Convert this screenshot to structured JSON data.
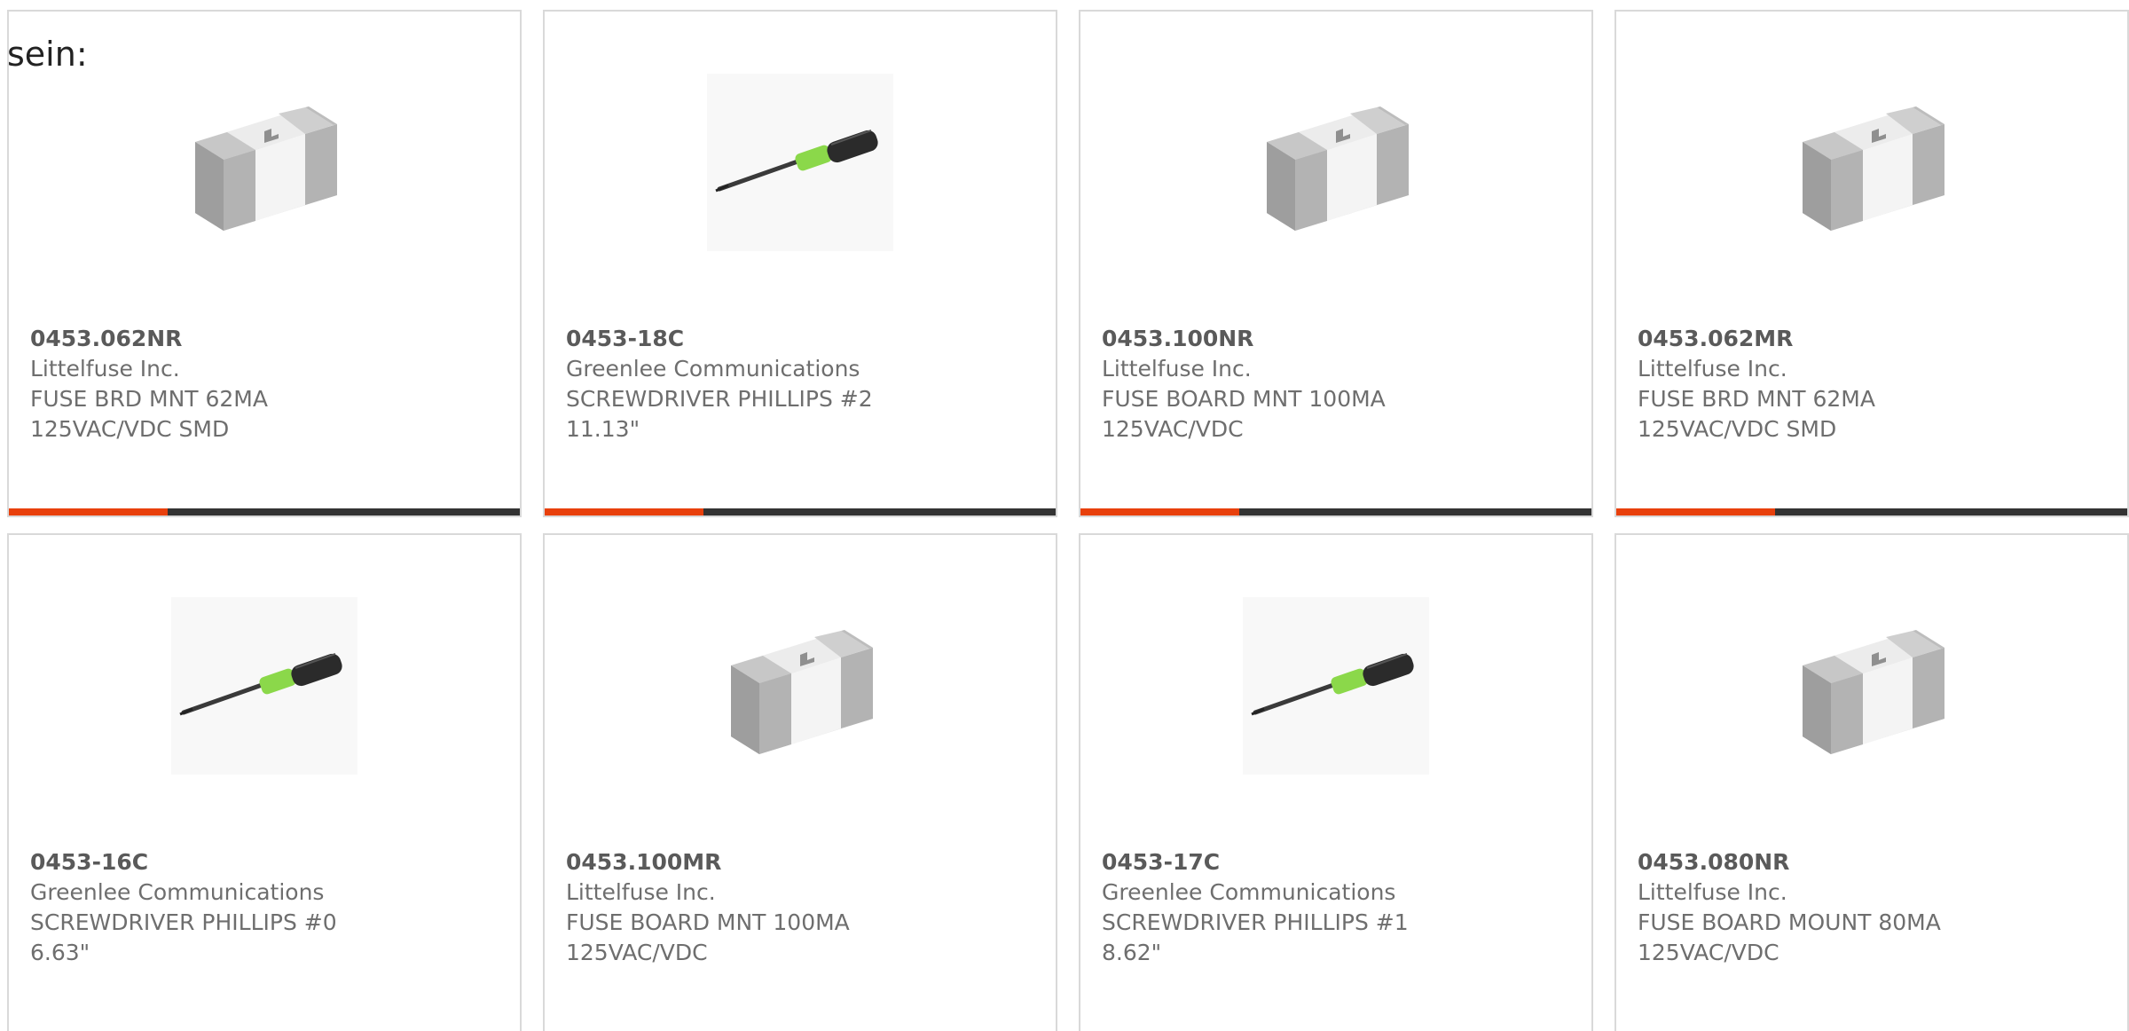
{
  "lead_text": "sein:",
  "colors": {
    "accent": "#e8400c",
    "track": "#333333",
    "border": "#d9d9d9"
  },
  "cards": [
    {
      "part": "0453.062NR",
      "manufacturer": "Littelfuse Inc.",
      "desc1": "FUSE BRD MNT 62MA",
      "desc2": "125VAC/VDC SMD",
      "image": "smd-fuse-icon",
      "progress_fraction": 0.31
    },
    {
      "part": "0453-18C",
      "manufacturer": "Greenlee Communications",
      "desc1": "SCREWDRIVER PHILLIPS #2",
      "desc2": "11.13\"",
      "image": "screwdriver-icon",
      "progress_fraction": 0.31
    },
    {
      "part": "0453.100NR",
      "manufacturer": "Littelfuse Inc.",
      "desc1": "FUSE BOARD MNT 100MA",
      "desc2": "125VAC/VDC",
      "image": "smd-fuse-icon",
      "progress_fraction": 0.31
    },
    {
      "part": "0453.062MR",
      "manufacturer": "Littelfuse Inc.",
      "desc1": "FUSE BRD MNT 62MA",
      "desc2": "125VAC/VDC SMD",
      "image": "smd-fuse-icon",
      "progress_fraction": 0.31
    },
    {
      "part": "0453-16C",
      "manufacturer": "Greenlee Communications",
      "desc1": "SCREWDRIVER PHILLIPS #0",
      "desc2": "6.63\"",
      "image": "screwdriver-icon"
    },
    {
      "part": "0453.100MR",
      "manufacturer": "Littelfuse Inc.",
      "desc1": "FUSE BOARD MNT 100MA",
      "desc2": "125VAC/VDC",
      "image": "smd-fuse-icon"
    },
    {
      "part": "0453-17C",
      "manufacturer": "Greenlee Communications",
      "desc1": "SCREWDRIVER PHILLIPS #1",
      "desc2": "8.62\"",
      "image": "screwdriver-icon"
    },
    {
      "part": "0453.080NR",
      "manufacturer": "Littelfuse Inc.",
      "desc1": "FUSE BOARD MOUNT 80MA",
      "desc2": "125VAC/VDC",
      "image": "smd-fuse-icon"
    }
  ]
}
